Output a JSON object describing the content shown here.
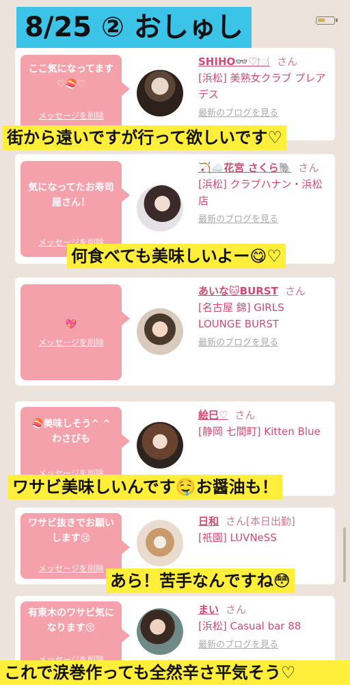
{
  "title": "8/25 ② おしゅし",
  "colors": {
    "banner": "#3cc3e8",
    "bubble": "#f5a1ac",
    "caption": "#ffef3a",
    "name": "#d04a70"
  },
  "delete_label": "メッセージを削除",
  "blog_label": "最新のブログを見る",
  "items": [
    {
      "message": "ここ気になってます♡🍣♡",
      "name": "SHIHO👓♡🍽️",
      "san": "さん",
      "shop": "[浜松] 美熟女クラブ プレアデス",
      "caption": "街から遠いですが行って欲しいです♡"
    },
    {
      "message": "気になってたお寿司屋さん！",
      "name": "🏹☁️花宮 さくら🐘",
      "san": "さん",
      "shop": "[浜松] クラブハナン・浜松店",
      "caption": "何食べても美味しいよー😋♡"
    },
    {
      "message": "💖",
      "name": "あいな🐱BURST",
      "san": "さん",
      "shop": "[名古屋 錦] GIRLS LOUNGE BURST",
      "caption": ""
    },
    {
      "message": "🍣美味しそう^ ^ わさびも",
      "name": "絵巳♡",
      "san": "さん",
      "shop": "[静岡 七間町] Kitten Blue",
      "caption": "ワサビ美味しいんです🤤お醤油も！"
    },
    {
      "message": "ワサビ抜きでお願いします😢",
      "name": "日和",
      "san": "さん[本日出勤]",
      "shop": "[祇園] LUVNeSS",
      "caption": "あら！苦手なんですね😳"
    },
    {
      "message": "有東木のワサビ気になります😚",
      "name": "まい",
      "san": "さん",
      "shop": "[浜松] Casual bar 88",
      "caption": "これで涙巻作っても全然辛さ平気そう♡"
    }
  ]
}
